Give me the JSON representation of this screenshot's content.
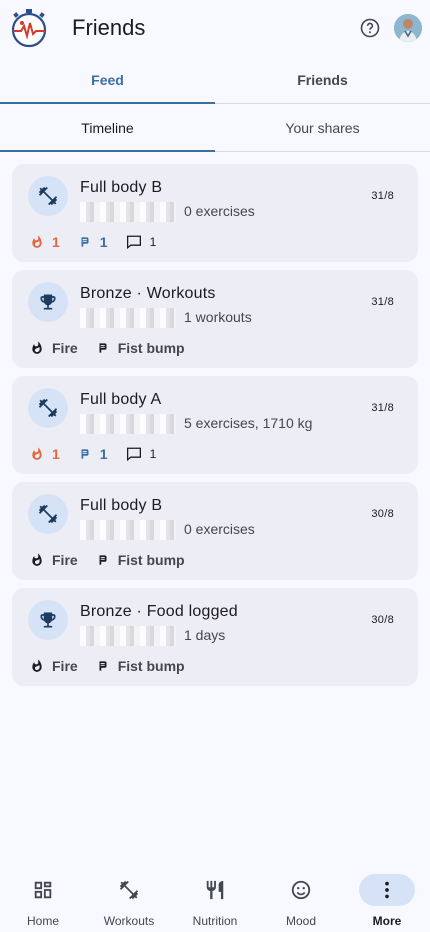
{
  "header": {
    "title": "Friends"
  },
  "tabs_primary": [
    {
      "label": "Feed",
      "active": true
    },
    {
      "label": "Friends",
      "active": false
    }
  ],
  "tabs_secondary": [
    {
      "label": "Timeline",
      "active": true
    },
    {
      "label": "Your shares",
      "active": false
    }
  ],
  "feed": [
    {
      "icon": "dumbbell-icon",
      "title": "Full body B",
      "subtitle": "0 exercises",
      "date": "31/8",
      "fire": "1",
      "bump": "1",
      "comments": "1",
      "mode": "counts"
    },
    {
      "icon": "trophy-icon",
      "title": "Bronze · Workouts",
      "subtitle": "1 workouts",
      "date": "31/8",
      "fire_label": "Fire",
      "bump_label": "Fist bump",
      "mode": "labels"
    },
    {
      "icon": "dumbbell-icon",
      "title": "Full body A",
      "subtitle": "5 exercises,  1710 kg",
      "date": "31/8",
      "fire": "1",
      "bump": "1",
      "comments": "1",
      "mode": "counts"
    },
    {
      "icon": "dumbbell-icon",
      "title": "Full body B",
      "subtitle": "0 exercises",
      "date": "30/8",
      "fire_label": "Fire",
      "bump_label": "Fist bump",
      "mode": "labels"
    },
    {
      "icon": "trophy-icon",
      "title": "Bronze · Food logged",
      "subtitle": "1 days",
      "date": "30/8",
      "fire_label": "Fire",
      "bump_label": "Fist bump",
      "mode": "labels"
    }
  ],
  "bottom_nav": [
    {
      "label": "Home",
      "icon": "dashboard-icon",
      "active": false
    },
    {
      "label": "Workouts",
      "icon": "dumbbell-icon",
      "active": false
    },
    {
      "label": "Nutrition",
      "icon": "utensils-icon",
      "active": false
    },
    {
      "label": "Mood",
      "icon": "smiley-icon",
      "active": false
    },
    {
      "label": "More",
      "icon": "more-vertical-icon",
      "active": true
    }
  ],
  "colors": {
    "accent": "#3a6ea5",
    "fire": "#e2683f",
    "card_bg": "#ededf6",
    "icon_circle": "#d6e3f7"
  }
}
